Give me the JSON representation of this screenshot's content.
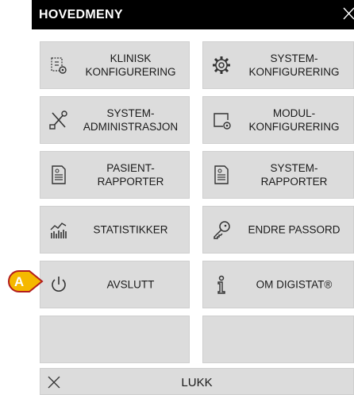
{
  "header": {
    "title": "HOVEDMENY"
  },
  "menu": {
    "klinisk": "KLINISK\nKONFIGURERING",
    "system_konf": "SYSTEM-\nKONFIGURERING",
    "system_admin": "SYSTEM-\nADMINISTRASJON",
    "modul_konf": "MODUL-\nKONFIGURERING",
    "pasient_rapporter": "PASIENT-\nRAPPORTER",
    "system_rapporter": "SYSTEM-\nRAPPORTER",
    "statistikker": "STATISTIKKER",
    "endre_passord": "ENDRE PASSORD",
    "avslutt": "AVSLUTT",
    "om_digistat": "OM DIGISTAT®",
    "lukk": "LUKK"
  },
  "callout": {
    "letter": "A",
    "color": "#f5b800"
  },
  "colors": {
    "tile": "#dcdcdc",
    "header": "#000000"
  }
}
